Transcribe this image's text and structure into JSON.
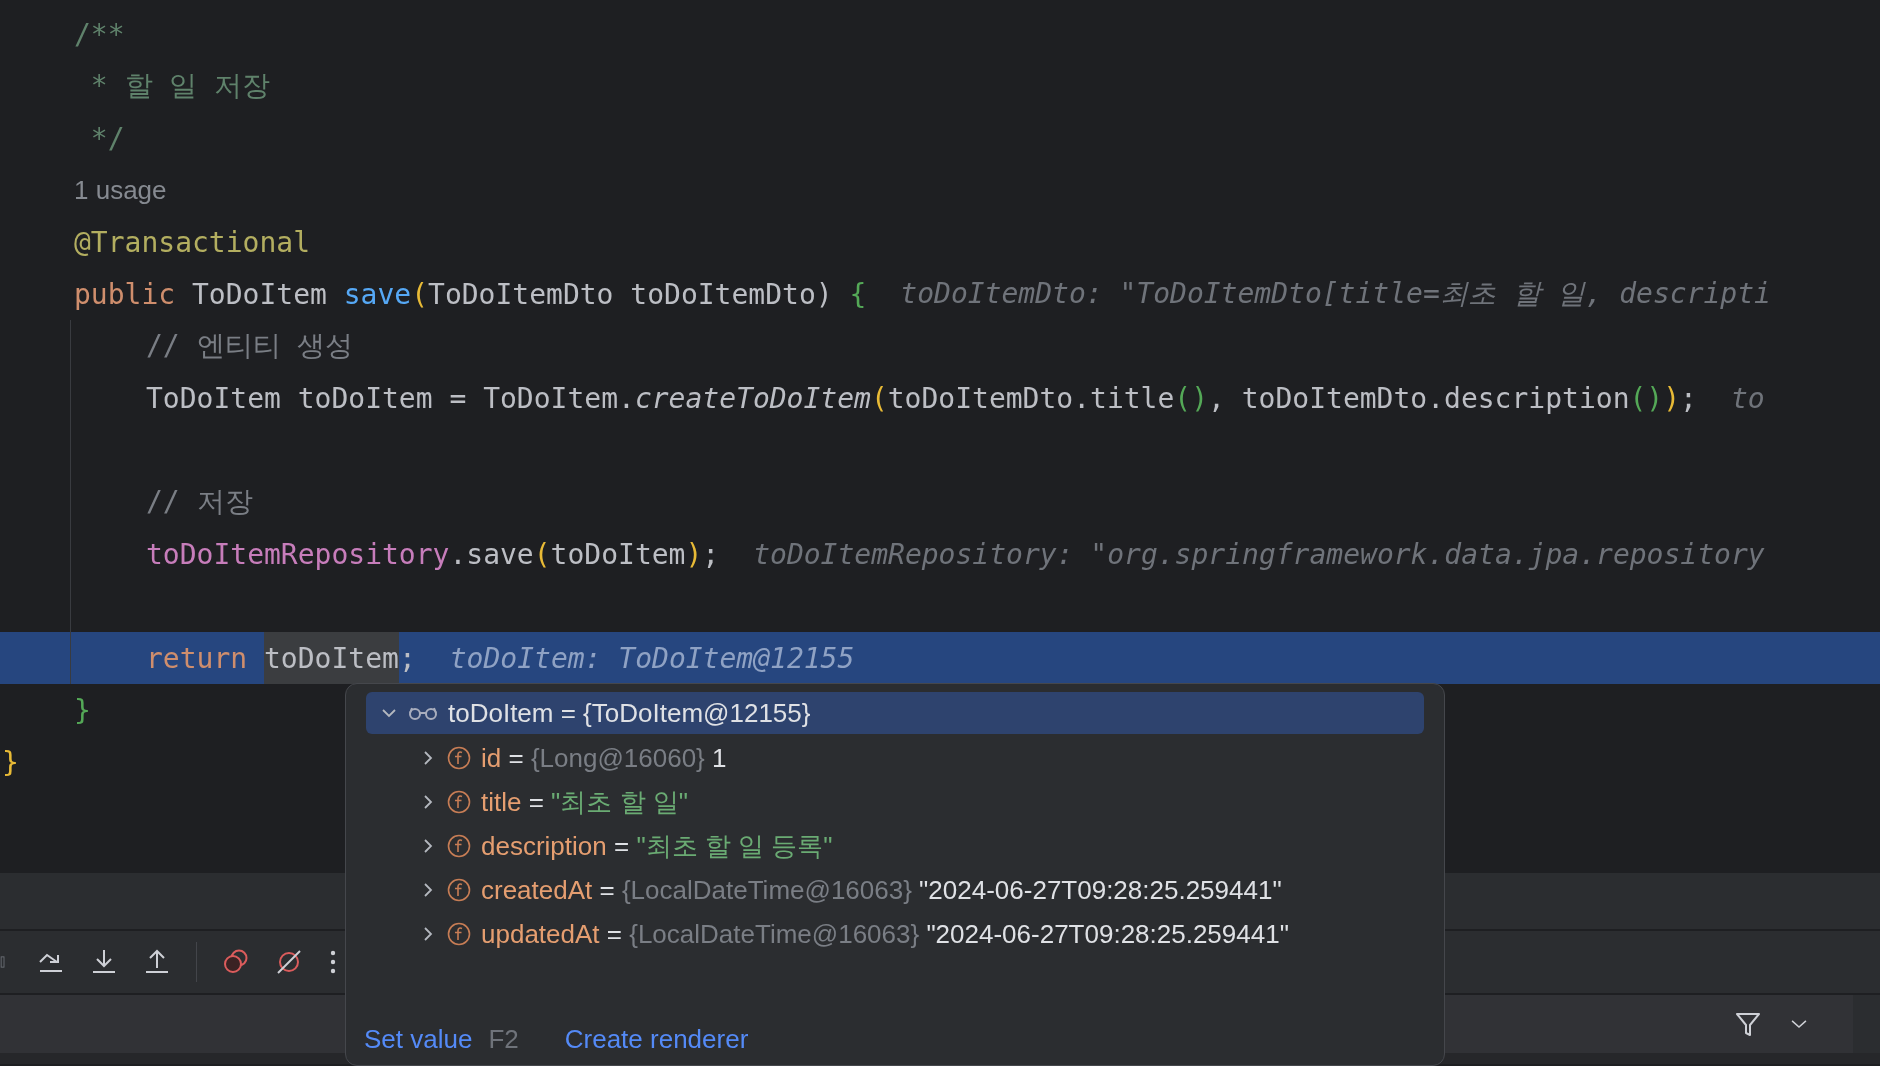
{
  "editor": {
    "lines": [
      {
        "kind": "member",
        "current": false,
        "tokens": [
          {
            "text": "/**",
            "kind": "doc"
          }
        ]
      },
      {
        "kind": "member",
        "current": false,
        "tokens": [
          {
            "text": " * 할 일 저장",
            "kind": "doc"
          }
        ]
      },
      {
        "kind": "member",
        "current": false,
        "tokens": [
          {
            "text": " */",
            "kind": "doc"
          }
        ]
      },
      {
        "kind": "member",
        "current": false,
        "tokens": [
          {
            "text": "1 usage",
            "kind": "usage"
          }
        ]
      },
      {
        "kind": "member",
        "current": false,
        "tokens": [
          {
            "text": "@Transactional",
            "kind": "annotation"
          }
        ]
      },
      {
        "kind": "member",
        "current": false,
        "tokens": [
          {
            "text": "public ",
            "kind": "keyword"
          },
          {
            "text": "ToDoItem ",
            "kind": "plain"
          },
          {
            "text": "save",
            "kind": "declaration"
          },
          {
            "text": "(",
            "kind": "bracket1"
          },
          {
            "text": "ToDoItemDto toDoItemDto) ",
            "kind": "plain"
          },
          {
            "text": "{",
            "kind": "bracket2"
          }
        ],
        "hint": "toDoItemDto: \"ToDoItemDto[title=최초 할 일, descripti"
      },
      {
        "kind": "body",
        "current": false,
        "tokens": [
          {
            "text": "// 엔티티 생성",
            "kind": "comment"
          }
        ]
      },
      {
        "kind": "body",
        "current": false,
        "tokens": [
          {
            "text": "ToDoItem toDoItem = ToDoItem.",
            "kind": "plain"
          },
          {
            "text": "createToDoItem",
            "kind": "static"
          },
          {
            "text": "(",
            "kind": "bracket1"
          },
          {
            "text": "toDoItemDto.title",
            "kind": "plain"
          },
          {
            "text": "()",
            "kind": "bracket2"
          },
          {
            "text": ", toDoItemDto.description",
            "kind": "plain"
          },
          {
            "text": "()",
            "kind": "bracket2"
          },
          {
            "text": ")",
            "kind": "bracket1"
          },
          {
            "text": ";",
            "kind": "plain"
          }
        ],
        "hint": "to"
      },
      {
        "kind": "body",
        "current": false
      },
      {
        "kind": "body",
        "current": false,
        "tokens": [
          {
            "text": "// 저장",
            "kind": "comment"
          }
        ]
      },
      {
        "kind": "body",
        "current": false,
        "tokens": [
          {
            "text": "toDoItemRepository",
            "kind": "field"
          },
          {
            "text": ".save",
            "kind": "plain"
          },
          {
            "text": "(",
            "kind": "bracket1"
          },
          {
            "text": "toDoItem",
            "kind": "plain"
          },
          {
            "text": ")",
            "kind": "bracket1"
          },
          {
            "text": ";",
            "kind": "plain"
          }
        ],
        "hint": "toDoItemRepository: \"org.springframework.data.jpa.repository"
      },
      {
        "kind": "body",
        "current": false
      },
      {
        "kind": "body",
        "current": true,
        "tokens": [
          {
            "text": "return ",
            "kind": "keyword"
          },
          {
            "text": "toDoItem",
            "kind": "selected"
          },
          {
            "text": ";",
            "kind": "plain"
          }
        ],
        "hint": "toDoItem: ToDoItem@12155"
      },
      {
        "kind": "member",
        "current": false,
        "tokens": [
          {
            "text": "}",
            "kind": "bracket2"
          }
        ]
      },
      {
        "kind": "top",
        "current": false,
        "tokens": [
          {
            "text": "}",
            "kind": "bracket1"
          }
        ]
      }
    ]
  },
  "popup": {
    "assign": "=",
    "root": {
      "name": "toDoItem",
      "value": "{ToDoItem@12155}",
      "expanded": true,
      "selected": true
    },
    "fields": [
      {
        "name": "id",
        "type": "{Long@16060}",
        "value": "1",
        "kind": "number",
        "expanded": false
      },
      {
        "name": "title",
        "value": "\"최초 할 일\"",
        "kind": "string",
        "expanded": false
      },
      {
        "name": "description",
        "value": "\"최초 할 일 등록\"",
        "kind": "string",
        "expanded": false
      },
      {
        "name": "createdAt",
        "type": "{LocalDateTime@16063}",
        "value": "\"2024-06-27T09:28:25.259441\"",
        "kind": "object",
        "expanded": false
      },
      {
        "name": "updatedAt",
        "type": "{LocalDateTime@16063}",
        "value": "\"2024-06-27T09:28:25.259441\"",
        "kind": "object",
        "expanded": false
      }
    ],
    "actions": [
      {
        "label": "Set value",
        "shortcut": "F2"
      },
      {
        "label": "Create renderer"
      }
    ]
  }
}
